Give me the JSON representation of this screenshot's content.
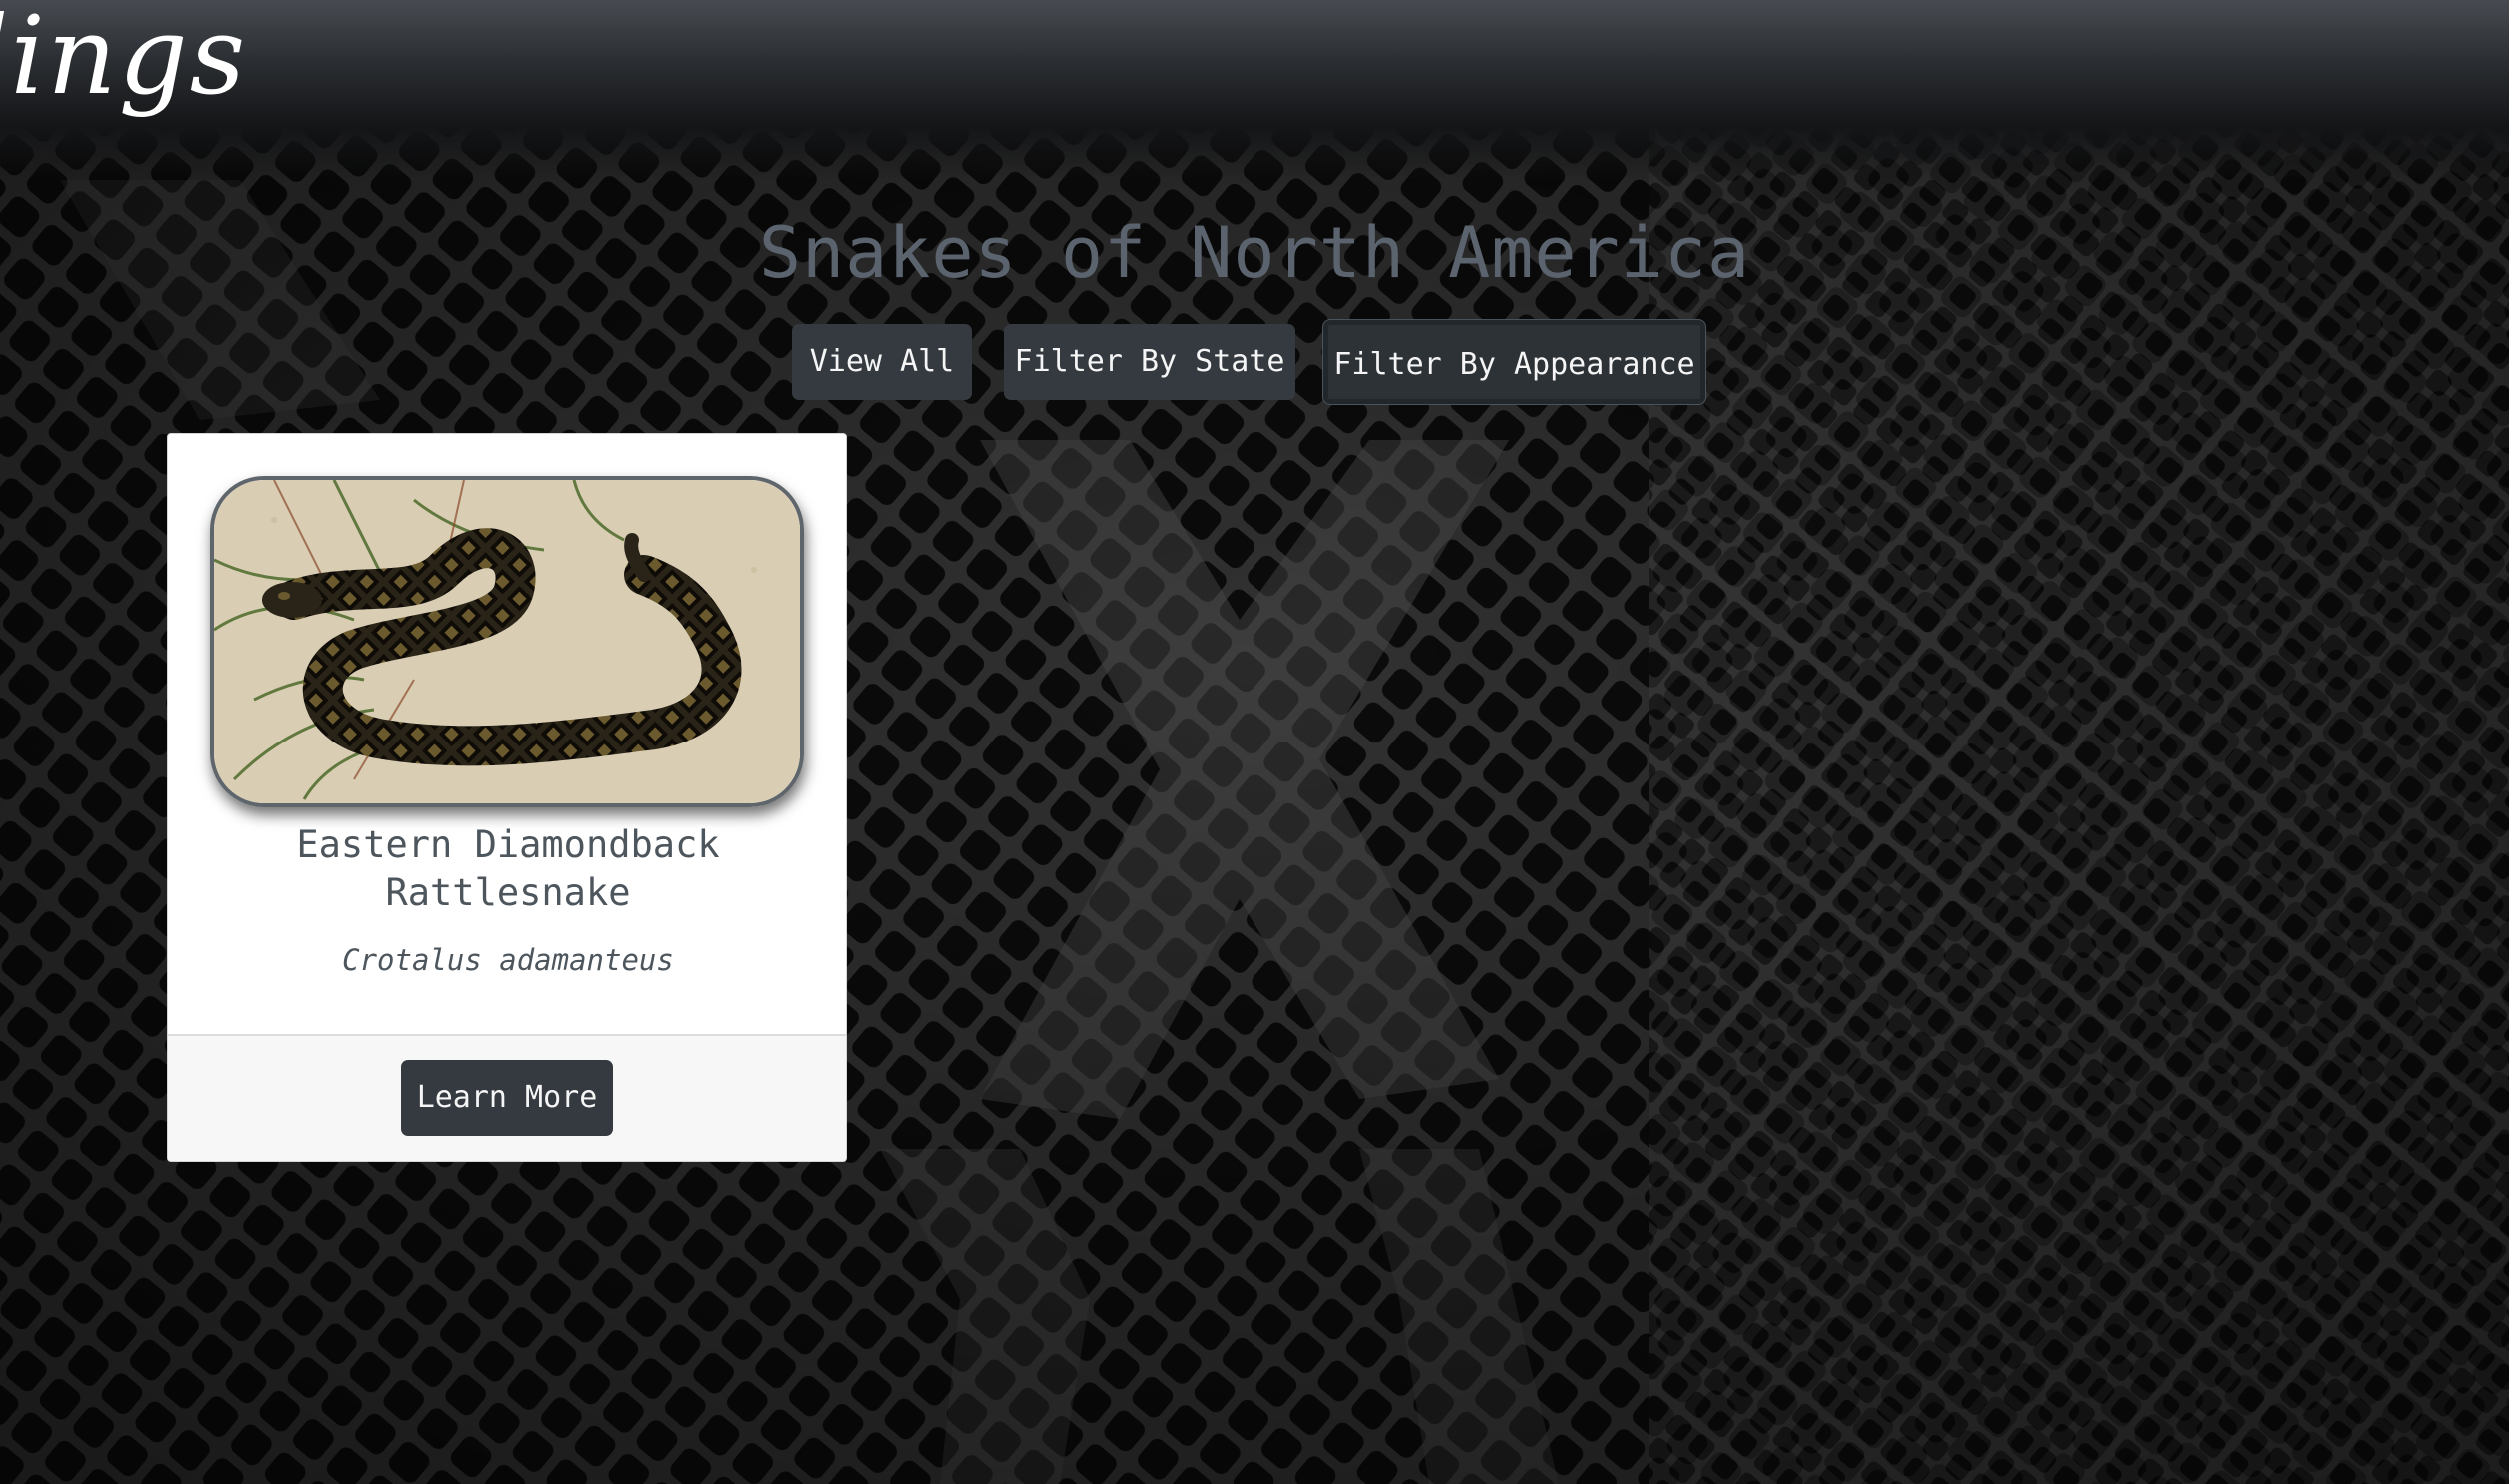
{
  "navbar": {
    "brand_partial": "lings"
  },
  "main": {
    "title": "Snakes of North America"
  },
  "filters": {
    "view_all": "View All",
    "filter_state": "Filter By State",
    "filter_appearance": "Filter By Appearance"
  },
  "cards": [
    {
      "common_name": "Eastern Diamondback Rattlesnake",
      "scientific_name": "Crotalus adamanteus",
      "button_label": "Learn More",
      "image_icon": "rattlesnake-photo"
    }
  ],
  "colors": {
    "button_bg": "#343a40",
    "title_text": "#5b646e",
    "card_text": "#4e565d"
  }
}
